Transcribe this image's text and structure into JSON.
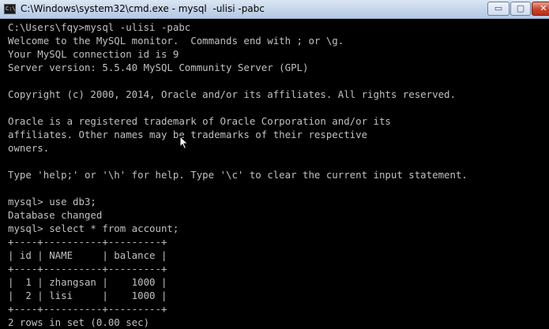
{
  "window": {
    "title": "C:\\Windows\\system32\\cmd.exe - mysql  -ulisi -pabc",
    "controls": {
      "minimize": "▭",
      "maximize": "▢",
      "close": "✕"
    }
  },
  "console": {
    "lines": [
      "C:\\Users\\fqy>mysql -ulisi -pabc",
      "Welcome to the MySQL monitor.  Commands end with ; or \\g.",
      "Your MySQL connection id is 9",
      "Server version: 5.5.40 MySQL Community Server (GPL)",
      "",
      "Copyright (c) 2000, 2014, Oracle and/or its affiliates. All rights reserved.",
      "",
      "Oracle is a registered trademark of Oracle Corporation and/or its",
      "affiliates. Other names may be trademarks of their respective",
      "owners.",
      "",
      "Type 'help;' or '\\h' for help. Type '\\c' to clear the current input statement.",
      "",
      "mysql> use db3;",
      "Database changed",
      "mysql> select * from account;",
      "+----+----------+---------+",
      "| id | NAME     | balance |",
      "+----+----------+---------+",
      "|  1 | zhangsan |    1000 |",
      "|  2 | lisi     |    1000 |",
      "+----+----------+---------+",
      "2 rows in set (0.00 sec)"
    ]
  }
}
